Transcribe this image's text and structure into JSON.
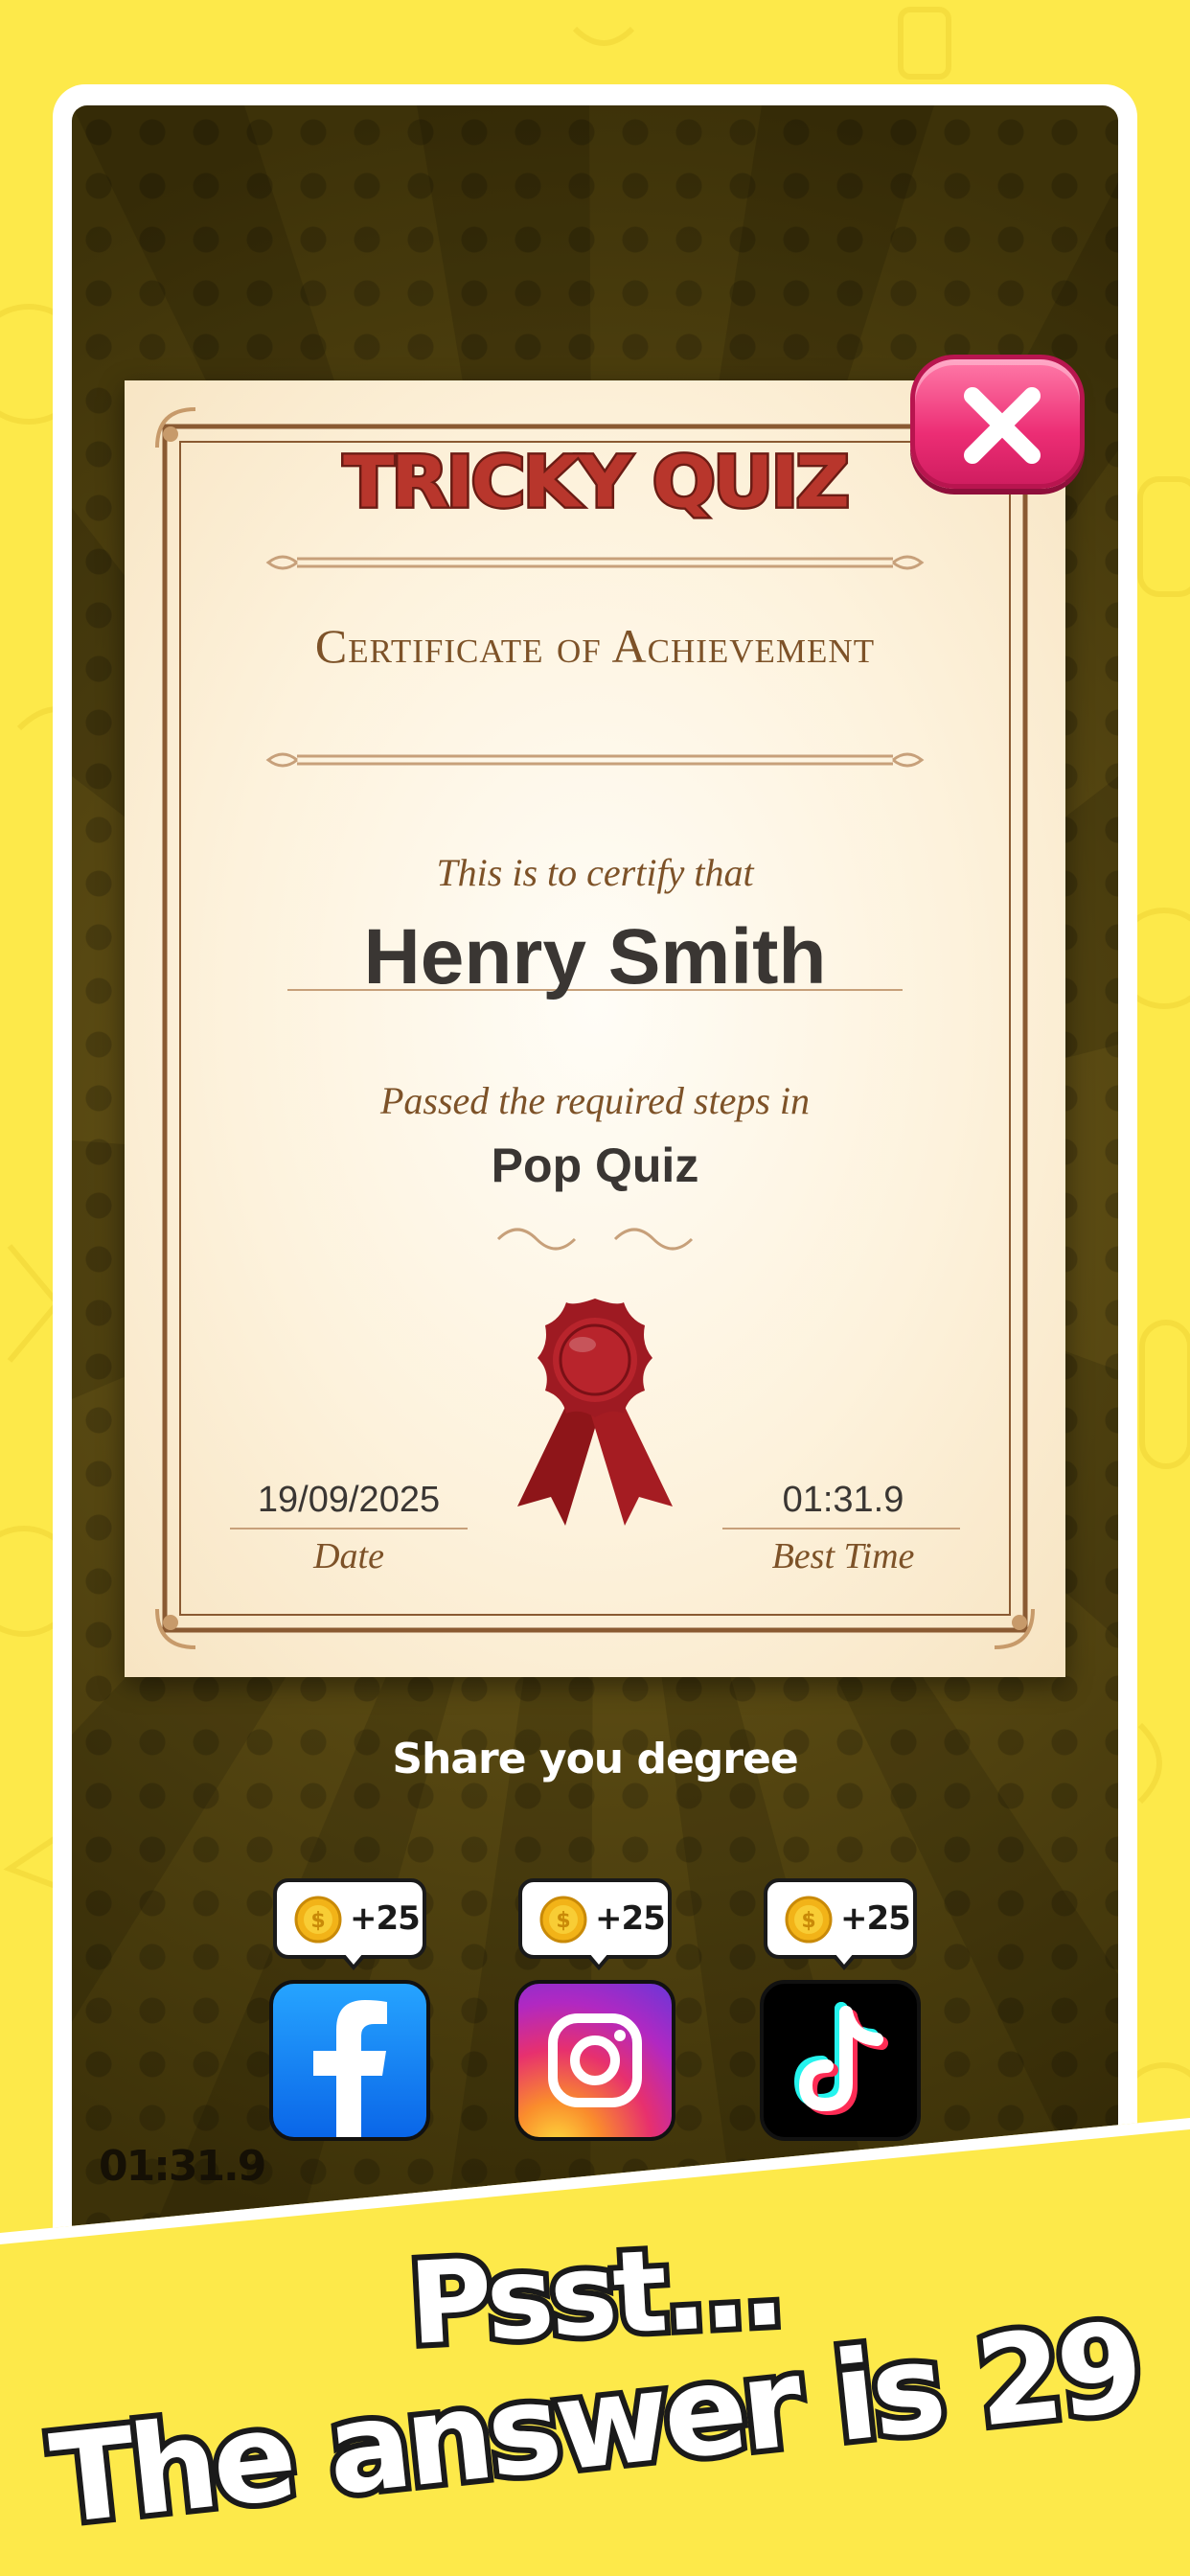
{
  "certificate": {
    "app_title": "TRICKY QUIZ",
    "heading": "Certificate of Achievement",
    "certify_text": "This is to certify that",
    "recipient_name": "Henry Smith",
    "passed_text": "Passed the required steps in",
    "quiz_name": "Pop Quiz",
    "date_value": "19/09/2025",
    "date_label": "Date",
    "best_time_value": "01:31.9",
    "best_time_label": "Best Time"
  },
  "share": {
    "label": "Share you degree",
    "items": [
      {
        "platform": "facebook",
        "icon": "facebook-icon",
        "reward": "+25"
      },
      {
        "platform": "instagram",
        "icon": "instagram-icon",
        "reward": "+25"
      },
      {
        "platform": "tiktok",
        "icon": "tiktok-icon",
        "reward": "+25"
      }
    ],
    "coin_icon": "coin-icon"
  },
  "game": {
    "timer": "01:31.9"
  },
  "close_icon": "close-icon",
  "banner": {
    "line1": "Psst...",
    "line2": "The answer is 29"
  },
  "colors": {
    "background": "#fde94a",
    "close_button": "#ec2d74",
    "certificate_title": "#b8362c",
    "certificate_text": "#7d5228",
    "seal": "#9e1a22"
  }
}
